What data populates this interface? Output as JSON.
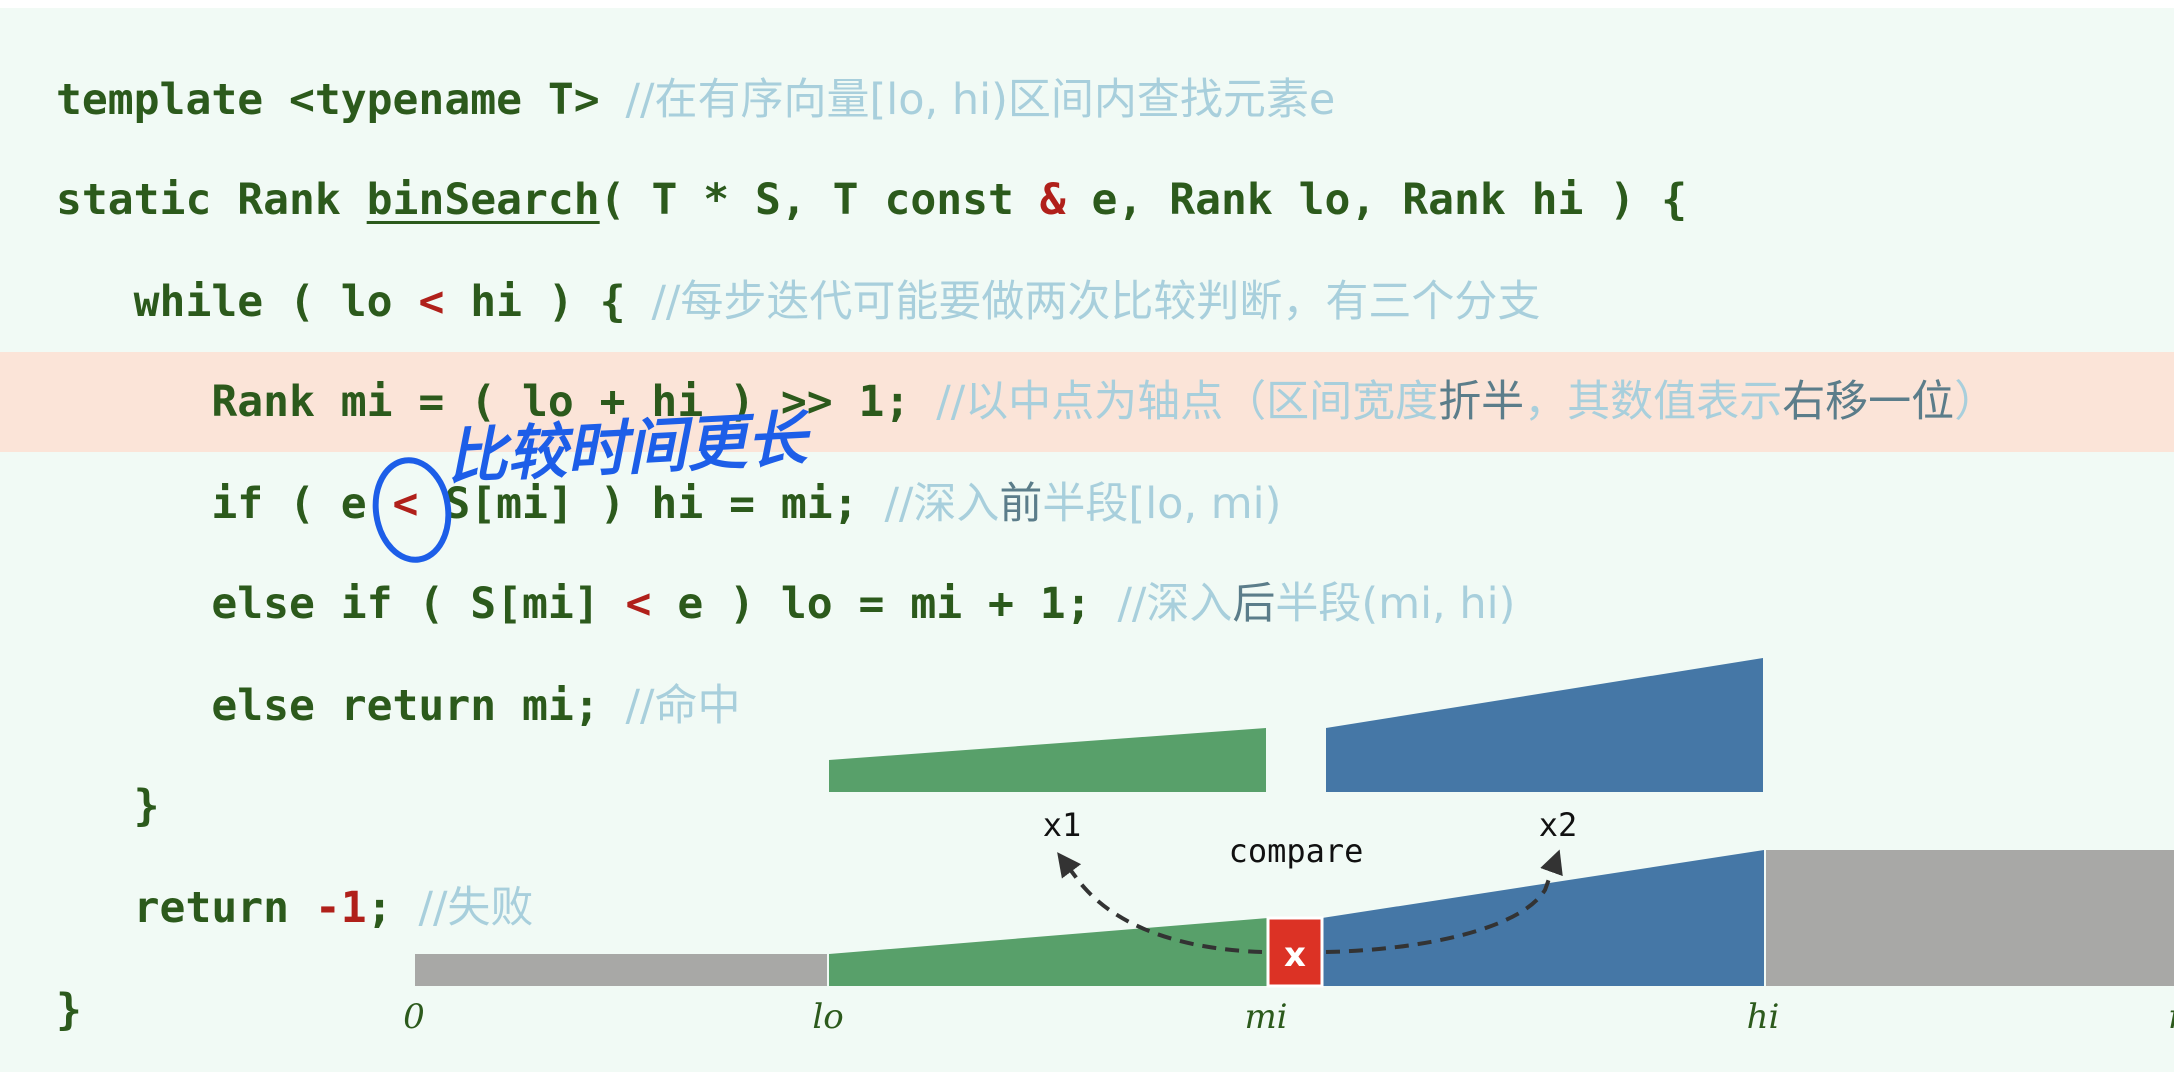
{
  "code": {
    "line1": {
      "code": "template <typename T> ",
      "comment": "//在有序向量[lo, hi)区间内查找元素e"
    },
    "line2": {
      "pre": "static Rank ",
      "fn": "binSearch",
      "mid": "( T * S, T const ",
      "op": "&",
      "post": " e, Rank lo, Rank hi ) {"
    },
    "line3": {
      "pre": "   while ( lo ",
      "op": "<",
      "post": " hi ) { ",
      "comment": "//每步迭代可能要做两次比较判断，有三个分支"
    },
    "line4": {
      "code": "      Rank mi = ( lo + hi ) >> 1; ",
      "c1": "//以中点为轴点（区间宽度",
      "c2": "折半",
      "c3": "，其数值表示",
      "c4": "右移一位",
      "c5": "）"
    },
    "line5": {
      "pre": "      if ( e ",
      "op": "<",
      "post": " S[mi] ) hi = mi; ",
      "c1": "//深入",
      "c2": "前",
      "c3": "半段[lo, mi)"
    },
    "line6": {
      "pre": "      else if ( S[mi] ",
      "op": "<",
      "post": " e ) lo = mi + 1; ",
      "c1": "//深入",
      "c2": "后",
      "c3": "半段(mi, hi)"
    },
    "line7": {
      "code": "      else return mi; ",
      "comment": "//命中"
    },
    "line8": {
      "code": "   }"
    },
    "line9": {
      "pre": "   return ",
      "op": "-1",
      "post": "; ",
      "comment": "//失败"
    },
    "line10": {
      "code": "}"
    }
  },
  "annotation": {
    "text": "比较时间更长"
  },
  "diagram": {
    "compare_label": "compare",
    "x1_label": "x1",
    "x2_label": "x2",
    "pivot_label": "x",
    "axis_labels": [
      "0",
      "lo",
      "mi",
      "hi",
      "n"
    ]
  },
  "colors": {
    "green": "#58a06a",
    "blue": "#4577a6",
    "gray": "#a8a8a6",
    "red": "#dc3225",
    "highlight": "#fbe4d8",
    "code": "#2c5a1c",
    "comment": "#a8cfdc",
    "pen": "#1d5ee8"
  }
}
